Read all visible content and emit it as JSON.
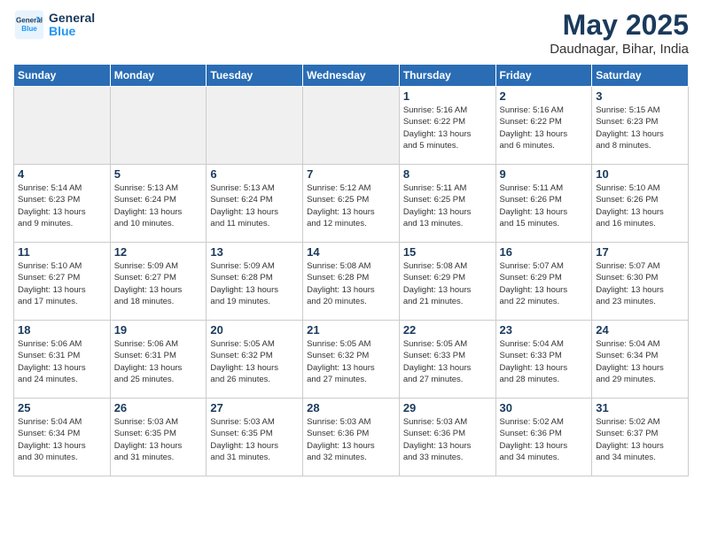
{
  "header": {
    "logo_line1": "General",
    "logo_line2": "Blue",
    "month": "May 2025",
    "location": "Daudnagar, Bihar, India"
  },
  "weekdays": [
    "Sunday",
    "Monday",
    "Tuesday",
    "Wednesday",
    "Thursday",
    "Friday",
    "Saturday"
  ],
  "weeks": [
    [
      {
        "day": "",
        "info": ""
      },
      {
        "day": "",
        "info": ""
      },
      {
        "day": "",
        "info": ""
      },
      {
        "day": "",
        "info": ""
      },
      {
        "day": "1",
        "info": "Sunrise: 5:16 AM\nSunset: 6:22 PM\nDaylight: 13 hours\nand 5 minutes."
      },
      {
        "day": "2",
        "info": "Sunrise: 5:16 AM\nSunset: 6:22 PM\nDaylight: 13 hours\nand 6 minutes."
      },
      {
        "day": "3",
        "info": "Sunrise: 5:15 AM\nSunset: 6:23 PM\nDaylight: 13 hours\nand 8 minutes."
      }
    ],
    [
      {
        "day": "4",
        "info": "Sunrise: 5:14 AM\nSunset: 6:23 PM\nDaylight: 13 hours\nand 9 minutes."
      },
      {
        "day": "5",
        "info": "Sunrise: 5:13 AM\nSunset: 6:24 PM\nDaylight: 13 hours\nand 10 minutes."
      },
      {
        "day": "6",
        "info": "Sunrise: 5:13 AM\nSunset: 6:24 PM\nDaylight: 13 hours\nand 11 minutes."
      },
      {
        "day": "7",
        "info": "Sunrise: 5:12 AM\nSunset: 6:25 PM\nDaylight: 13 hours\nand 12 minutes."
      },
      {
        "day": "8",
        "info": "Sunrise: 5:11 AM\nSunset: 6:25 PM\nDaylight: 13 hours\nand 13 minutes."
      },
      {
        "day": "9",
        "info": "Sunrise: 5:11 AM\nSunset: 6:26 PM\nDaylight: 13 hours\nand 15 minutes."
      },
      {
        "day": "10",
        "info": "Sunrise: 5:10 AM\nSunset: 6:26 PM\nDaylight: 13 hours\nand 16 minutes."
      }
    ],
    [
      {
        "day": "11",
        "info": "Sunrise: 5:10 AM\nSunset: 6:27 PM\nDaylight: 13 hours\nand 17 minutes."
      },
      {
        "day": "12",
        "info": "Sunrise: 5:09 AM\nSunset: 6:27 PM\nDaylight: 13 hours\nand 18 minutes."
      },
      {
        "day": "13",
        "info": "Sunrise: 5:09 AM\nSunset: 6:28 PM\nDaylight: 13 hours\nand 19 minutes."
      },
      {
        "day": "14",
        "info": "Sunrise: 5:08 AM\nSunset: 6:28 PM\nDaylight: 13 hours\nand 20 minutes."
      },
      {
        "day": "15",
        "info": "Sunrise: 5:08 AM\nSunset: 6:29 PM\nDaylight: 13 hours\nand 21 minutes."
      },
      {
        "day": "16",
        "info": "Sunrise: 5:07 AM\nSunset: 6:29 PM\nDaylight: 13 hours\nand 22 minutes."
      },
      {
        "day": "17",
        "info": "Sunrise: 5:07 AM\nSunset: 6:30 PM\nDaylight: 13 hours\nand 23 minutes."
      }
    ],
    [
      {
        "day": "18",
        "info": "Sunrise: 5:06 AM\nSunset: 6:31 PM\nDaylight: 13 hours\nand 24 minutes."
      },
      {
        "day": "19",
        "info": "Sunrise: 5:06 AM\nSunset: 6:31 PM\nDaylight: 13 hours\nand 25 minutes."
      },
      {
        "day": "20",
        "info": "Sunrise: 5:05 AM\nSunset: 6:32 PM\nDaylight: 13 hours\nand 26 minutes."
      },
      {
        "day": "21",
        "info": "Sunrise: 5:05 AM\nSunset: 6:32 PM\nDaylight: 13 hours\nand 27 minutes."
      },
      {
        "day": "22",
        "info": "Sunrise: 5:05 AM\nSunset: 6:33 PM\nDaylight: 13 hours\nand 27 minutes."
      },
      {
        "day": "23",
        "info": "Sunrise: 5:04 AM\nSunset: 6:33 PM\nDaylight: 13 hours\nand 28 minutes."
      },
      {
        "day": "24",
        "info": "Sunrise: 5:04 AM\nSunset: 6:34 PM\nDaylight: 13 hours\nand 29 minutes."
      }
    ],
    [
      {
        "day": "25",
        "info": "Sunrise: 5:04 AM\nSunset: 6:34 PM\nDaylight: 13 hours\nand 30 minutes."
      },
      {
        "day": "26",
        "info": "Sunrise: 5:03 AM\nSunset: 6:35 PM\nDaylight: 13 hours\nand 31 minutes."
      },
      {
        "day": "27",
        "info": "Sunrise: 5:03 AM\nSunset: 6:35 PM\nDaylight: 13 hours\nand 31 minutes."
      },
      {
        "day": "28",
        "info": "Sunrise: 5:03 AM\nSunset: 6:36 PM\nDaylight: 13 hours\nand 32 minutes."
      },
      {
        "day": "29",
        "info": "Sunrise: 5:03 AM\nSunset: 6:36 PM\nDaylight: 13 hours\nand 33 minutes."
      },
      {
        "day": "30",
        "info": "Sunrise: 5:02 AM\nSunset: 6:36 PM\nDaylight: 13 hours\nand 34 minutes."
      },
      {
        "day": "31",
        "info": "Sunrise: 5:02 AM\nSunset: 6:37 PM\nDaylight: 13 hours\nand 34 minutes."
      }
    ]
  ]
}
